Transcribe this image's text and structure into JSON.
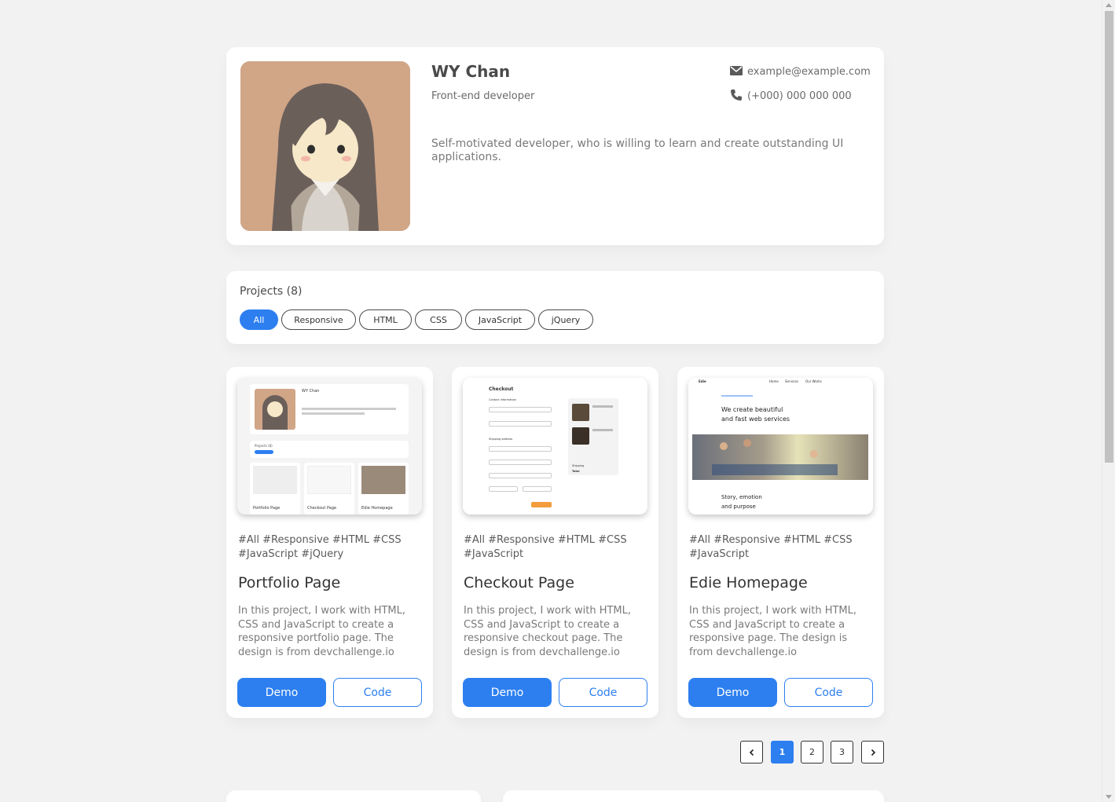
{
  "profile": {
    "name": "WY Chan",
    "role": "Front-end developer",
    "email": "example@example.com",
    "phone": "(+000) 000 000 000",
    "bio": "Self-motivated developer, who is willing to learn and create outstanding UI applications."
  },
  "projects": {
    "heading": "Projects",
    "count": "(8)",
    "filters": [
      "All",
      "Responsive",
      "HTML",
      "CSS",
      "JavaScript",
      "jQuery"
    ],
    "active_filter": "All",
    "cards": [
      {
        "tags": "#All #Responsive #HTML #CSS #JavaScript #jQuery",
        "title": "Portfolio Page",
        "description": "In this project, I work with HTML, CSS and JavaScript to create a responsive portfolio page. The design is from devchallenge.io",
        "demo_label": "Demo",
        "code_label": "Code",
        "thumb": {
          "name": "WY Chan",
          "label1": "Portfolio Page",
          "label2": "Checkout Page",
          "label3": "Edie Homepage",
          "projects": "Projects (8)"
        }
      },
      {
        "tags": "#All #Responsive #HTML #CSS #JavaScript",
        "title": "Checkout Page",
        "description": "In this project, I work with HTML, CSS and JavaScript to create a responsive checkout page. The design is from devchallenge.io",
        "demo_label": "Demo",
        "code_label": "Code",
        "thumb": {
          "heading": "Checkout",
          "contact": "Contact information",
          "shipping": "Shipping address",
          "ship_label": "Shipping",
          "total_label": "Total"
        }
      },
      {
        "tags": "#All #Responsive #HTML #CSS #JavaScript",
        "title": "Edie Homepage",
        "description": "In this project, I work with HTML, CSS and JavaScript to create a responsive page. The design is from devchallenge.io",
        "demo_label": "Demo",
        "code_label": "Code",
        "thumb": {
          "brand": "Edie",
          "nav1": "Home",
          "nav2": "Services",
          "nav3": "Our Works",
          "headline1": "We create beautiful",
          "headline2": "and fast web services",
          "sub1": "Story, emotion",
          "sub2": "and purpose"
        }
      }
    ]
  },
  "pagination": {
    "prev_icon": "chevron-left-icon",
    "pages": [
      "1",
      "2",
      "3"
    ],
    "current": "1",
    "next_icon": "chevron-right-icon"
  },
  "colors": {
    "accent": "#2d7ff0",
    "background": "#f2f2f2",
    "avatar_bg": "#d0a687"
  }
}
